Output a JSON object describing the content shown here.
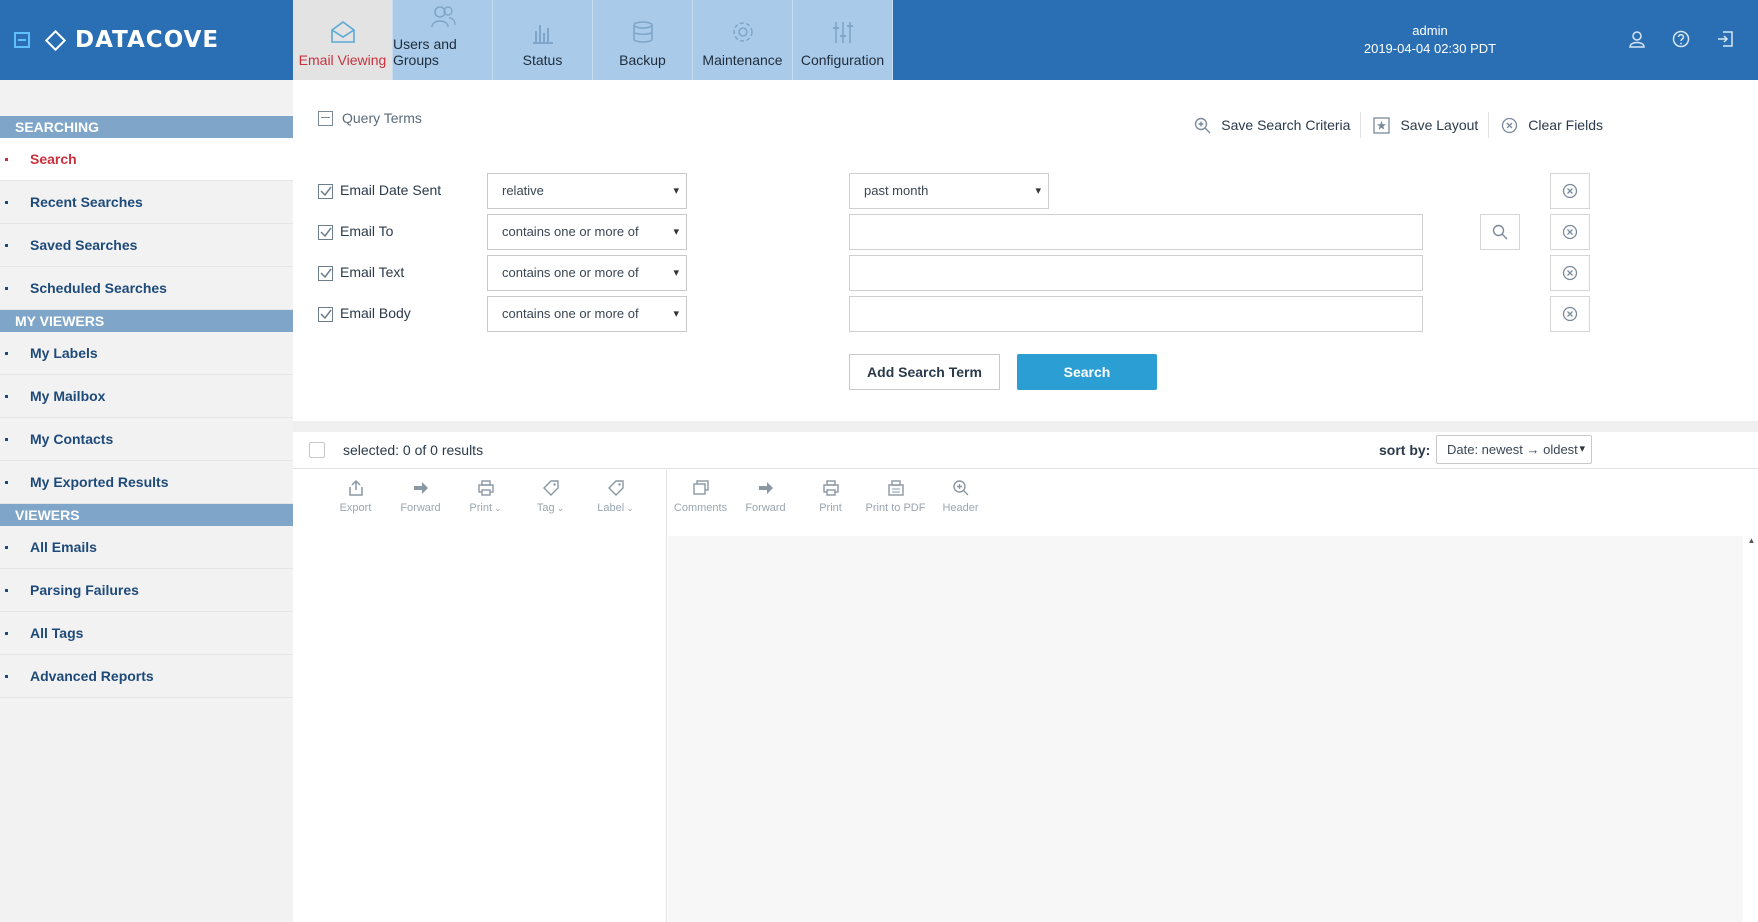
{
  "brand": {
    "name": "DATACOVE"
  },
  "tabs": [
    {
      "label": "Email Viewing",
      "icon": "envelope-icon"
    },
    {
      "label": "Users and Groups",
      "icon": "users-icon"
    },
    {
      "label": "Status",
      "icon": "bar-chart-icon"
    },
    {
      "label": "Backup",
      "icon": "database-icon"
    },
    {
      "label": "Maintenance",
      "icon": "gear-icon"
    },
    {
      "label": "Configuration",
      "icon": "sliders-icon"
    }
  ],
  "user": {
    "name": "admin",
    "datetime": "2019-04-04 02:30 PDT"
  },
  "sidebar": {
    "searching_title": "SEARCHING",
    "searching": [
      "Search",
      "Recent Searches",
      "Saved Searches",
      "Scheduled Searches"
    ],
    "my_viewers_title": "MY VIEWERS",
    "my_viewers": [
      "My Labels",
      "My Mailbox",
      "My Contacts",
      "My Exported Results"
    ],
    "viewers_title": "VIEWERS",
    "viewers": [
      "All Emails",
      "Parsing Failures",
      "All Tags",
      "Advanced Reports"
    ]
  },
  "query": {
    "title": "Query Terms",
    "save_criteria": "Save Search Criteria",
    "save_layout": "Save Layout",
    "clear_fields": "Clear Fields",
    "terms": [
      {
        "label": "Email Date Sent",
        "operator": "relative",
        "value": "past month"
      },
      {
        "label": "Email To",
        "operator": "contains one or more of",
        "value": ""
      },
      {
        "label": "Email Text",
        "operator": "contains one or more of",
        "value": ""
      },
      {
        "label": "Email Body",
        "operator": "contains one or more of",
        "value": ""
      }
    ],
    "add_term": "Add Search Term",
    "search": "Search"
  },
  "results": {
    "selected_text": "selected: 0 of 0 results",
    "sort_label": "sort by:",
    "sort_value": "Date: newest → oldest"
  },
  "toolbar_left": [
    {
      "label": "Export",
      "icon": "export-icon"
    },
    {
      "label": "Forward",
      "icon": "forward-icon"
    },
    {
      "label": "Print",
      "icon": "print-icon",
      "dropdown": true
    },
    {
      "label": "Tag",
      "icon": "tag-icon",
      "dropdown": true
    },
    {
      "label": "Label",
      "icon": "label-icon",
      "dropdown": true
    }
  ],
  "toolbar_right": [
    {
      "label": "Comments",
      "icon": "comments-icon"
    },
    {
      "label": "Forward",
      "icon": "forward-icon"
    },
    {
      "label": "Print",
      "icon": "print-icon"
    },
    {
      "label": "Print to PDF",
      "icon": "pdf-icon"
    },
    {
      "label": "Header",
      "icon": "zoom-in-icon"
    }
  ],
  "colors": {
    "header": "#2a6fb3",
    "accent": "#c9323d",
    "search_button": "#2b9fd3"
  }
}
